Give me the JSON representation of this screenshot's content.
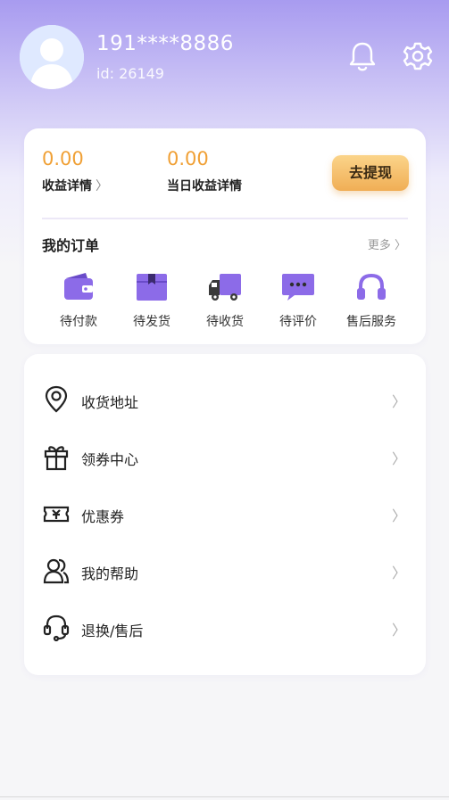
{
  "user": {
    "phone": "191****8886",
    "id_text": "id: 26149"
  },
  "header_icons": [
    "bell-icon",
    "gear-icon"
  ],
  "earnings": {
    "total_amount": "0.00",
    "total_label": "收益详情",
    "today_amount": "0.00",
    "today_label": "当日收益详情",
    "withdraw_label": "去提现"
  },
  "orders": {
    "title": "我的订单",
    "more": "更多",
    "items": [
      {
        "label": "待付款",
        "icon": "wallet-icon"
      },
      {
        "label": "待发货",
        "icon": "box-icon"
      },
      {
        "label": "待收货",
        "icon": "truck-icon"
      },
      {
        "label": "待评价",
        "icon": "chat-icon"
      },
      {
        "label": "售后服务",
        "icon": "headphones-icon"
      }
    ]
  },
  "menu": [
    {
      "label": "收货地址",
      "icon": "location-pin-icon"
    },
    {
      "label": "领券中心",
      "icon": "gift-icon"
    },
    {
      "label": "优惠券",
      "icon": "coupon-icon"
    },
    {
      "label": "我的帮助",
      "icon": "users-icon"
    },
    {
      "label": "退换/售后",
      "icon": "headset-icon"
    }
  ],
  "colors": {
    "accent_purple": "#8c6be8",
    "amount_orange": "#f0a035",
    "header_gradient_top": "#a89bf0"
  }
}
